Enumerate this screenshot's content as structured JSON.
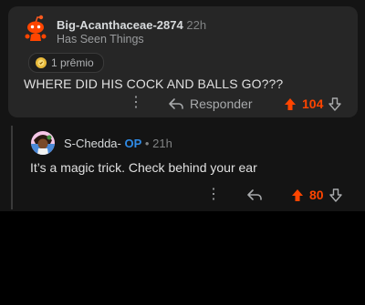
{
  "comment1": {
    "author": "Big-Acanthaceae-2874",
    "time": "22h",
    "flair": "Has Seen Things",
    "award_label": "1 prêmio",
    "body": "WHERE DID HIS COCK AND BALLS GO???",
    "reply_label": "Responder",
    "score": "104",
    "icons": [
      "snoo-avatar-icon",
      "award-icon",
      "more-dots-icon",
      "reply-arrow-icon",
      "upvote-icon",
      "downvote-icon"
    ]
  },
  "comment2": {
    "author": "S-Chedda-",
    "op_badge": "OP",
    "separator": "•",
    "time": "21h",
    "body": "It’s a magic trick. Check behind your ear",
    "score": "80",
    "icons": [
      "user-avatar-icon",
      "more-dots-icon",
      "reply-arrow-icon",
      "upvote-icon",
      "downvote-icon"
    ]
  },
  "colors": {
    "background": "#141414",
    "card": "#262626",
    "upvote": "#ff4500",
    "op": "#2f8be6",
    "text": "#e0e0e0",
    "muted": "#818384"
  }
}
